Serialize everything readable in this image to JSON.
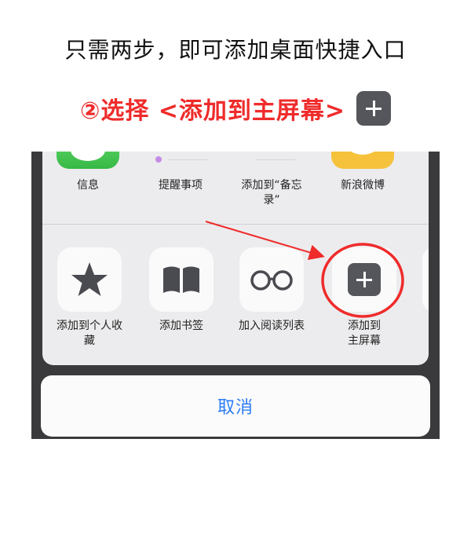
{
  "header": {
    "title": "只需两步，即可添加桌面快捷入口",
    "step": "②选择 <添加到主屏幕>",
    "step_icon": "plus-icon"
  },
  "share_sheet": {
    "apps": [
      {
        "label": "信息",
        "icon": "messages-icon"
      },
      {
        "label": "提醒事项",
        "icon": "reminders-icon"
      },
      {
        "label": "添加到“备忘\n录”",
        "icon": "notes-icon"
      },
      {
        "label": "新浪微博",
        "icon": "weibo-icon"
      }
    ],
    "actions": [
      {
        "label": "添加到个人收\n藏",
        "icon": "star-icon"
      },
      {
        "label": "添加书签",
        "icon": "book-icon"
      },
      {
        "label": "加入阅读列表",
        "icon": "glasses-icon"
      },
      {
        "label": "添加到\n主屏幕",
        "icon": "plus-icon"
      }
    ],
    "cancel_label": "取消"
  },
  "colors": {
    "highlight_red": "#ef2b2b",
    "cancel_blue": "#2d7cf6",
    "icon_gray": "#55565b"
  }
}
